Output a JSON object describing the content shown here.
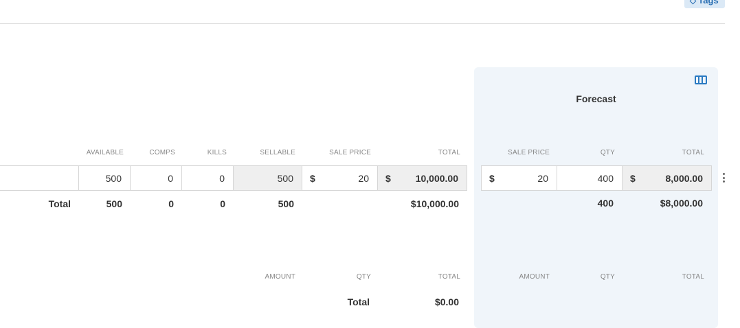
{
  "header": {
    "tags_label": "Tags"
  },
  "forecast": {
    "title": "Forecast",
    "headers": {
      "sale_price": "SALE PRICE",
      "qty": "QTY",
      "total": "TOTAL"
    },
    "row": {
      "currency": "$",
      "sale_price": "20",
      "qty": "400",
      "total": "8,000.00"
    },
    "totals": {
      "qty": "400",
      "total": "$8,000.00"
    },
    "extra_headers": {
      "amount": "AMOUNT",
      "qty": "QTY",
      "total": "TOTAL"
    }
  },
  "tickets": {
    "headers": {
      "available": "AVAILABLE",
      "comps": "COMPS",
      "kills": "KILLS",
      "sellable": "SELLABLE",
      "sale_price": "SALE PRICE",
      "total": "TOTAL"
    },
    "row": {
      "available": "500",
      "comps": "0",
      "kills": "0",
      "sellable": "500",
      "currency": "$",
      "sale_price": "20",
      "total": "10,000.00"
    },
    "totals": {
      "label": "Total",
      "available": "500",
      "comps": "0",
      "kills": "0",
      "sellable": "500",
      "total": "$10,000.00"
    }
  },
  "extras": {
    "headers": {
      "amount": "AMOUNT",
      "qty": "QTY",
      "total": "TOTAL"
    },
    "totals": {
      "label": "Total",
      "total": "$0.00"
    }
  }
}
